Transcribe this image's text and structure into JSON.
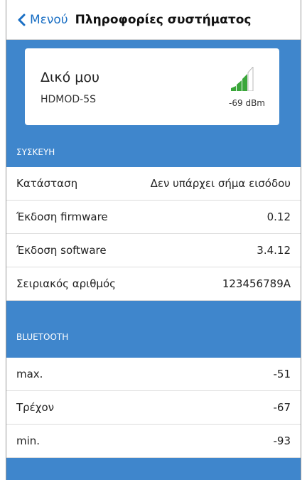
{
  "nav": {
    "back_label": "Μενού",
    "title": "Πληροφορίες συστήματος"
  },
  "device": {
    "name": "Δικό μου",
    "model": "HDMOD-5S",
    "signal": "-69 dBm",
    "signal_icon": "signal-bars-icon",
    "signal_bars_active": 3,
    "signal_bars_total": 4
  },
  "sections": {
    "device": {
      "header": "ΣΥΣΚΕΥΗ",
      "rows": [
        {
          "label": "Κατάσταση",
          "value": "Δεν υπάρχει σήμα εισόδου"
        },
        {
          "label": "Έκδοση firmware",
          "value": "0.12"
        },
        {
          "label": "Έκδοση software",
          "value": "3.4.12"
        },
        {
          "label": "Σειριακός αριθμός",
          "value": "123456789A"
        }
      ]
    },
    "bluetooth": {
      "header": "BLUETOOTH",
      "rows": [
        {
          "label": "max.",
          "value": "-51"
        },
        {
          "label": "Τρέχον",
          "value": "-67"
        },
        {
          "label": "min.",
          "value": "-93"
        }
      ]
    }
  },
  "colors": {
    "accent": "#3f86cc",
    "link": "#1a6fc4",
    "signal_active": "#3aa63a",
    "signal_inactive": "#b9b9b9"
  }
}
